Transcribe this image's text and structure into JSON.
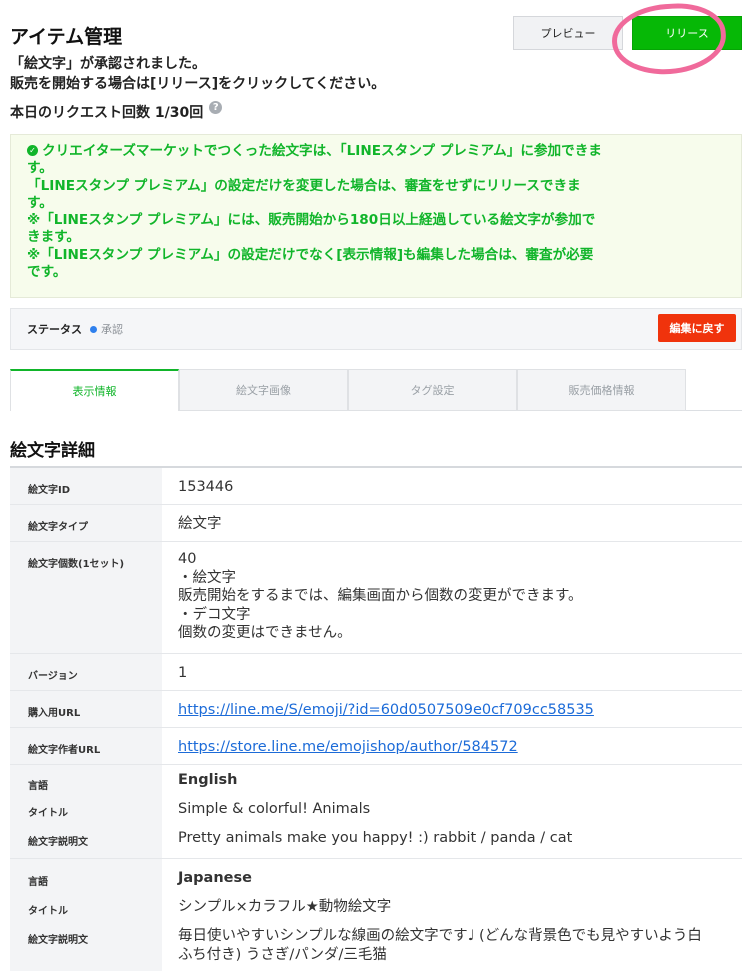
{
  "header": {
    "title": "アイテム管理",
    "preview_label": "プレビュー",
    "release_label": "リリース"
  },
  "status_message": {
    "line1": "「絵文字」が承認されました。",
    "line2": "販売を開始する場合は[リリース]をクリックしてください。"
  },
  "request_count": "本日のリクエスト回数 1/30回",
  "help_icon_glyph": "?",
  "notice": {
    "check_glyph": "✓",
    "lines": [
      "クリエイターズマーケットでつくった絵文字は、「LINEスタンプ プレミアム」に参加できま",
      "す。",
      "「LINEスタンプ プレミアム」の設定だけを変更した場合は、審査をせずにリリースできま",
      "す。",
      "※「LINEスタンプ プレミアム」には、販売開始から180日以上経過している絵文字が参加で",
      "きます。",
      "※「LINEスタンプ プレミアム」の設定だけでなく[表示情報]も編集した場合は、審査が必要",
      "です。"
    ]
  },
  "status_bar": {
    "label": "ステータス",
    "value": "承認",
    "back_button": "編集に戻す"
  },
  "tabs": [
    {
      "label": "表示情報",
      "active": true
    },
    {
      "label": "絵文字画像",
      "active": false
    },
    {
      "label": "タグ設定",
      "active": false
    },
    {
      "label": "販売価格情報",
      "active": false
    }
  ],
  "section_title": "絵文字詳細",
  "details": {
    "id_label": "絵文字ID",
    "id_value": "153446",
    "type_label": "絵文字タイプ",
    "type_value": "絵文字",
    "count_label": "絵文字個数(1セット)",
    "count_lines": [
      "40",
      "・絵文字",
      "販売開始をするまでは、編集画面から個数の変更ができます。",
      "・デコ文字",
      "個数の変更はできません。"
    ],
    "version_label": "バージョン",
    "version_value": "1",
    "purchase_url_label": "購入用URL",
    "purchase_url": "https://line.me/S/emoji/?id=60d0507509e0cf709cc58535",
    "author_url_label": "絵文字作者URL",
    "author_url": "https://store.line.me/emojishop/author/584572"
  },
  "languages": [
    {
      "lang_label": "言語",
      "lang": "English",
      "title_label": "タイトル",
      "title": "Simple & colorful! Animals",
      "desc_label": "絵文字説明文",
      "desc": "Pretty animals make you happy! :) rabbit / panda / cat"
    },
    {
      "lang_label": "言語",
      "lang": "Japanese",
      "title_label": "タイトル",
      "title": "シンプル×カラフル★動物絵文字",
      "desc_label": "絵文字説明文",
      "desc_line1": "毎日使いやすいシンプルな線画の絵文字です♩ (どんな背景色でも見やすいよう白",
      "desc_line2": "ふち付き) うさぎ/パンダ/三毛猫"
    }
  ],
  "colors": {
    "accent_green": "#06b806",
    "notice_green": "#11b52a",
    "danger_red": "#f0330c",
    "link_blue": "#1c6bd8",
    "highlight_pink": "#f06a9b"
  }
}
